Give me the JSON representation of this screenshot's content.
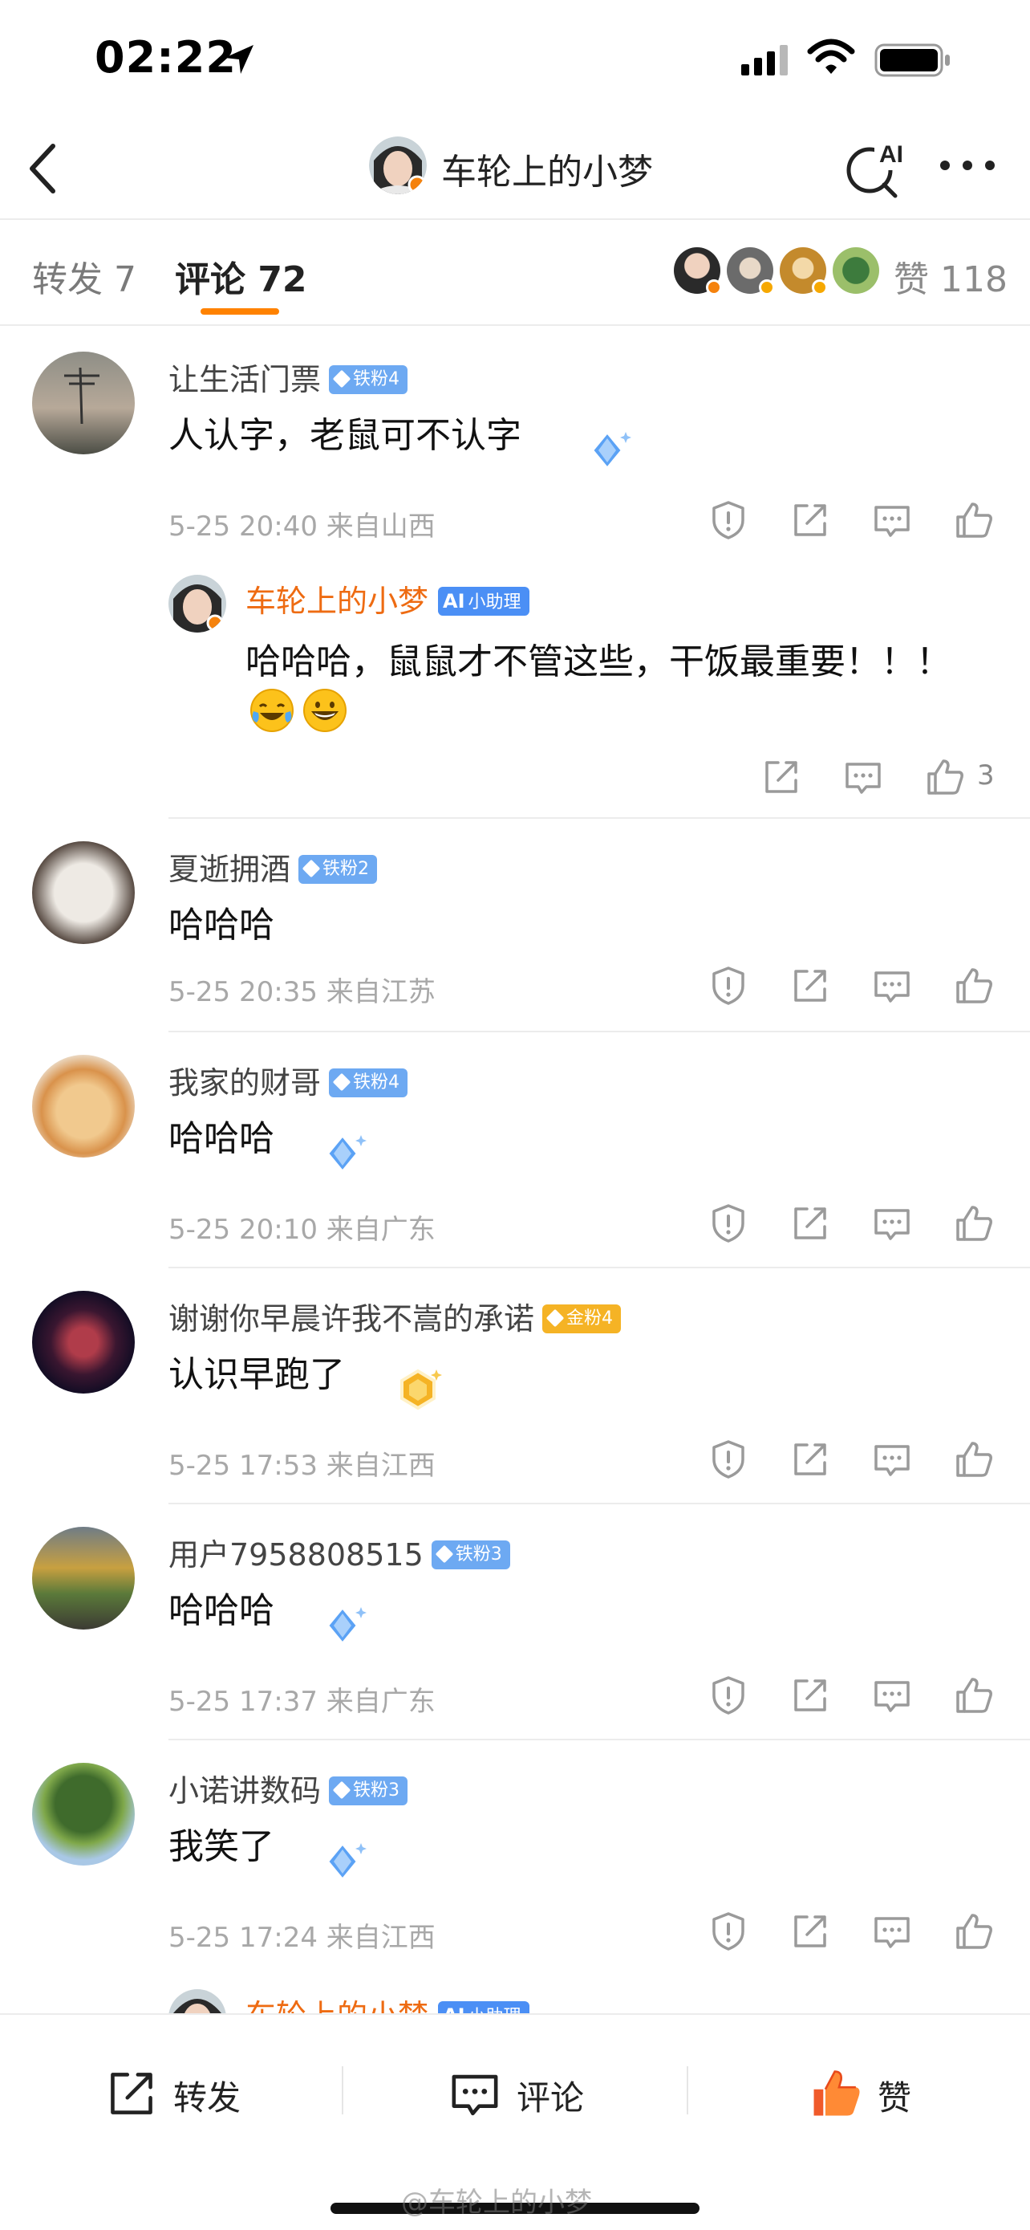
{
  "status_bar": {
    "time": "02:22"
  },
  "nav": {
    "title": "车轮上的小梦"
  },
  "tabs": {
    "repost": "转发 7",
    "comment": "评论 72",
    "likes": "赞 118"
  },
  "comments": [
    {
      "user": "让生活门票",
      "badge": "铁粉4",
      "text": "人认字，老鼠可不认字",
      "meta": "5-25 20:40  来自山西",
      "reply": {
        "user": "车轮上的小梦",
        "badge": "小助理",
        "text": "哈哈哈，鼠鼠才不管这些，干饭最重要！！！",
        "likes": "3"
      }
    },
    {
      "user": "夏逝拥酒",
      "badge": "铁粉2",
      "text": "哈哈哈",
      "meta": "5-25 20:35  来自江苏"
    },
    {
      "user": "我家的财哥",
      "badge": "铁粉4",
      "text": "哈哈哈",
      "meta": "5-25 20:10  来自广东"
    },
    {
      "user": "谢谢你早晨许我不嵩的承诺",
      "badge": "金粉4",
      "text": "认识早跑了",
      "meta": "5-25 17:53  来自江西"
    },
    {
      "user": "用户7958808515",
      "badge": "铁粉3",
      "text": "哈哈哈",
      "meta": "5-25 17:37  来自广东"
    },
    {
      "user": "小诺讲数码",
      "badge": "铁粉3",
      "text": "我笑了",
      "meta": "5-25 17:24  来自江西"
    }
  ],
  "peek_reply": {
    "user": "车轮上的小梦",
    "badge": "小助理"
  },
  "bottom_bar": {
    "repost": "转发",
    "comment": "评论",
    "like": "赞"
  },
  "watermark": "@车轮上的小梦",
  "colors": {
    "accent": "#ff8200",
    "reply_name": "#ee6b12",
    "fan_badge": "#6da9f2",
    "gold_badge": "#f5b325",
    "assistant_badge": "#4b8ff5"
  }
}
